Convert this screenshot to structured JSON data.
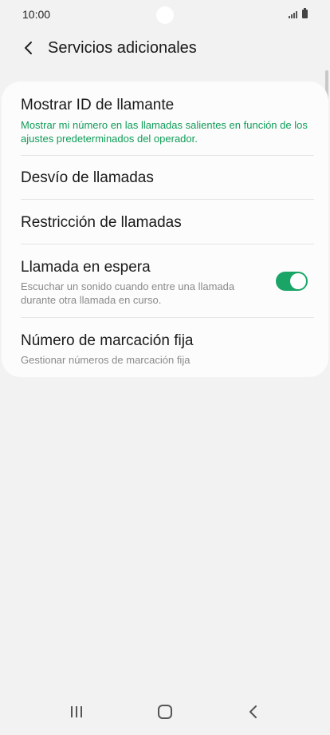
{
  "status_bar": {
    "time": "10:00",
    "icons": [
      "signal-icon",
      "battery-icon"
    ]
  },
  "header": {
    "back_icon": "chevron-left-icon",
    "title": "Servicios adicionales"
  },
  "settings": {
    "items": [
      {
        "title": "Mostrar ID de llamante",
        "subtitle": "Mostrar mi número en las llamadas salientes en función de los ajustes predeterminados del operador."
      },
      {
        "title": "Desvío de llamadas"
      },
      {
        "title": "Restricción de llamadas"
      },
      {
        "title": "Llamada en espera",
        "subtitle": "Escuchar un sonido cuando entre una llamada durante otra llamada en curso.",
        "toggle_on": true
      },
      {
        "title": "Número de marcación fija",
        "subtitle": "Gestionar números de marcación fija"
      }
    ]
  },
  "colors": {
    "accent_green": "#1aa567",
    "subtitle_green": "#0f9d58",
    "background": "#f2f2f2"
  },
  "nav_bar": {
    "icons": [
      "recent-apps-icon",
      "home-icon",
      "back-icon"
    ]
  }
}
